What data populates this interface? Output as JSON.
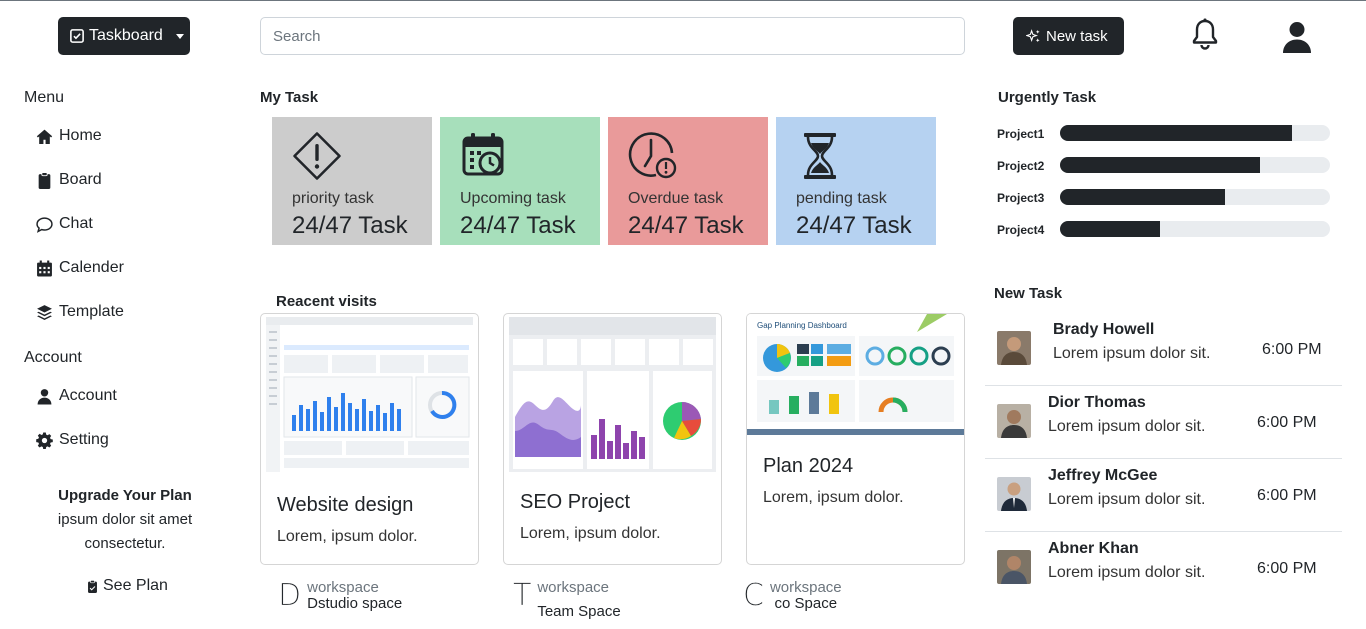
{
  "header": {
    "brand_label": "Taskboard",
    "search_placeholder": "Search",
    "new_task_label": "New task"
  },
  "sidebar": {
    "menu_heading": "Menu",
    "menu_items": [
      {
        "label": "Home",
        "icon": "home-icon"
      },
      {
        "label": "Board",
        "icon": "clipboard-icon"
      },
      {
        "label": "Chat",
        "icon": "chat-icon"
      },
      {
        "label": "Calender",
        "icon": "calendar-icon"
      },
      {
        "label": "Template",
        "icon": "layers-icon"
      }
    ],
    "account_heading": "Account",
    "account_items": [
      {
        "label": "Account",
        "icon": "person-icon"
      },
      {
        "label": "Setting",
        "icon": "gear-icon"
      }
    ],
    "upgrade": {
      "title": "Upgrade Your Plan",
      "line1": "ipsum dolor sit amet",
      "line2": "consectetur."
    },
    "see_plan_label": "See Plan"
  },
  "my_task": {
    "title": "My Task",
    "cards": [
      {
        "label": "priority task",
        "count": "24/47 Task",
        "icon": "warning-diamond-icon",
        "color": "#cccccc"
      },
      {
        "label": "Upcoming task",
        "count": "24/47 Task",
        "icon": "calendar-clock-icon",
        "color": "#a7dfbb"
      },
      {
        "label": "Overdue task",
        "count": "24/47 Task",
        "icon": "clock-alert-icon",
        "color": "#e99a9a"
      },
      {
        "label": "pending task",
        "count": "24/47 Task",
        "icon": "hourglass-icon",
        "color": "#b6d2f1"
      }
    ]
  },
  "recent": {
    "title": "Reacent visits",
    "cards": [
      {
        "name": "Website design",
        "desc": "Lorem, ipsum dolor.",
        "ws_letter": "D",
        "ws_label": "workspace",
        "ws_name": "Dstudio space"
      },
      {
        "name": "SEO Project",
        "desc": "Lorem, ipsum dolor.",
        "ws_letter": "T",
        "ws_label": "workspace",
        "ws_name": "Team Space"
      },
      {
        "name": "Plan 2024",
        "desc": "Lorem, ipsum dolor.",
        "ws_letter": "C",
        "ws_label": "workspace",
        "ws_name": "co Space",
        "thumb_title": "Gap Planning Dashboard"
      }
    ]
  },
  "urgent": {
    "title": "Urgently Task",
    "projects": [
      {
        "name": "Project1",
        "progress": 0.86
      },
      {
        "name": "Project2",
        "progress": 0.74
      },
      {
        "name": "Project3",
        "progress": 0.61
      },
      {
        "name": "Project4",
        "progress": 0.37
      }
    ]
  },
  "new_task": {
    "title": "New Task",
    "items": [
      {
        "name": "Brady Howell",
        "desc": "Lorem ipsum dolor sit.",
        "time": "6:00 PM"
      },
      {
        "name": "Dior Thomas",
        "desc": "Lorem ipsum dolor sit.",
        "time": "6:00 PM"
      },
      {
        "name": "Jeffrey McGee",
        "desc": "Lorem ipsum dolor sit.",
        "time": "6:00 PM"
      },
      {
        "name": "Abner Khan",
        "desc": "Lorem ipsum dolor sit.",
        "time": "6:00 PM"
      }
    ]
  }
}
